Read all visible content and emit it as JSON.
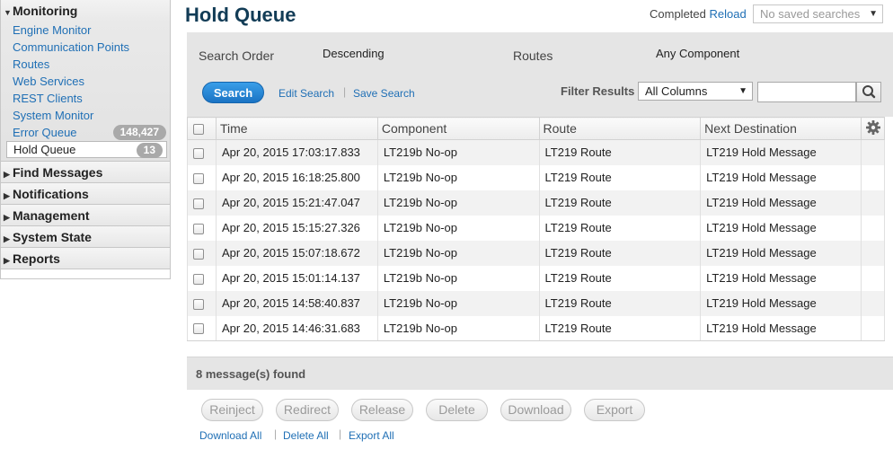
{
  "sidebar": {
    "monitoring": {
      "title": "Monitoring",
      "items": [
        {
          "label": "Engine Monitor"
        },
        {
          "label": "Communication Points"
        },
        {
          "label": "Routes"
        },
        {
          "label": "Web Services"
        },
        {
          "label": "REST Clients"
        },
        {
          "label": "System Monitor"
        },
        {
          "label": "Error Queue",
          "count": "148,427"
        },
        {
          "label": "Hold Queue",
          "count": "13"
        }
      ]
    },
    "sections": [
      {
        "title": "Find Messages"
      },
      {
        "title": "Notifications"
      },
      {
        "title": "Management"
      },
      {
        "title": "System State"
      },
      {
        "title": "Reports"
      }
    ]
  },
  "header": {
    "title": "Hold Queue",
    "status": "Completed",
    "reload": "Reload",
    "saved_searches": "No saved searches"
  },
  "search": {
    "order_label": "Search Order",
    "order_value": "Descending",
    "routes_label": "Routes",
    "routes_value": "Any Component",
    "search_button": "Search",
    "edit_search": "Edit Search",
    "save_search": "Save Search",
    "filter_label": "Filter Results",
    "filter_value": "All Columns",
    "filter_input": ""
  },
  "table": {
    "columns": [
      "Time",
      "Component",
      "Route",
      "Next Destination"
    ],
    "rows": [
      {
        "time": "Apr 20, 2015 17:03:17.833",
        "component": "LT219b No-op",
        "route": "LT219 Route",
        "next": "LT219 Hold Message"
      },
      {
        "time": "Apr 20, 2015 16:18:25.800",
        "component": "LT219b No-op",
        "route": "LT219 Route",
        "next": "LT219 Hold Message"
      },
      {
        "time": "Apr 20, 2015 15:21:47.047",
        "component": "LT219b No-op",
        "route": "LT219 Route",
        "next": "LT219 Hold Message"
      },
      {
        "time": "Apr 20, 2015 15:15:27.326",
        "component": "LT219b No-op",
        "route": "LT219 Route",
        "next": "LT219 Hold Message"
      },
      {
        "time": "Apr 20, 2015 15:07:18.672",
        "component": "LT219b No-op",
        "route": "LT219 Route",
        "next": "LT219 Hold Message"
      },
      {
        "time": "Apr 20, 2015 15:01:14.137",
        "component": "LT219b No-op",
        "route": "LT219 Route",
        "next": "LT219 Hold Message"
      },
      {
        "time": "Apr 20, 2015 14:58:40.837",
        "component": "LT219b No-op",
        "route": "LT219 Route",
        "next": "LT219 Hold Message"
      },
      {
        "time": "Apr 20, 2015 14:46:31.683",
        "component": "LT219b No-op",
        "route": "LT219 Route",
        "next": "LT219 Hold Message"
      }
    ],
    "found_text": "8 message(s) found"
  },
  "actions": {
    "reinject": "Reinject",
    "redirect": "Redirect",
    "release": "Release",
    "delete": "Delete",
    "download": "Download",
    "export": "Export"
  },
  "bottom_links": {
    "download_all": "Download All",
    "delete_all": "Delete All",
    "export_all": "Export All"
  },
  "icons": {
    "search": "search-icon",
    "gear": "gear-icon",
    "expand": "triangle-down-icon",
    "collapse": "triangle-right-icon"
  },
  "colors": {
    "accent": "#1a73c4",
    "link": "#1f6fb5",
    "title": "#123c56",
    "badge": "#a9a9a9"
  }
}
